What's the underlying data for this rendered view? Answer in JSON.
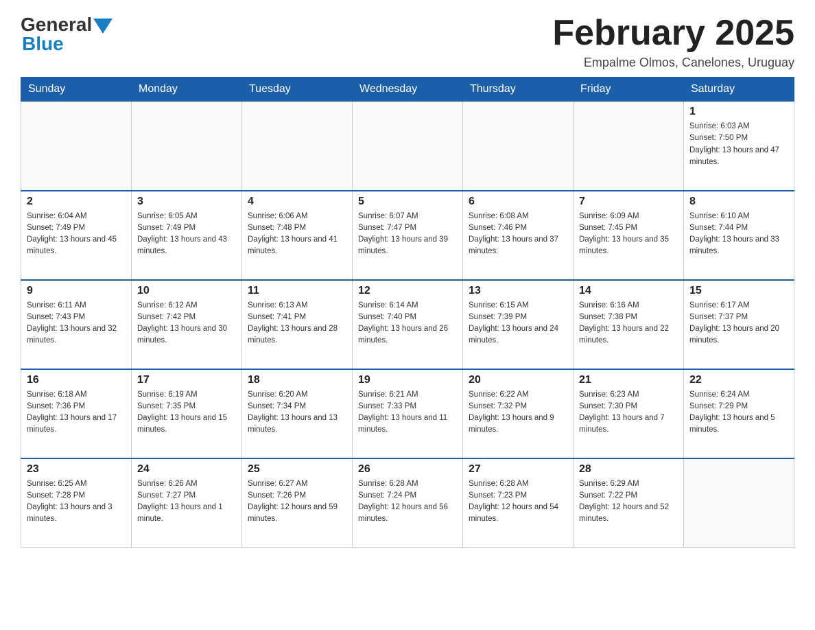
{
  "header": {
    "logo_general": "General",
    "logo_blue": "Blue",
    "month_title": "February 2025",
    "subtitle": "Empalme Olmos, Canelones, Uruguay"
  },
  "days_of_week": [
    "Sunday",
    "Monday",
    "Tuesday",
    "Wednesday",
    "Thursday",
    "Friday",
    "Saturday"
  ],
  "weeks": [
    {
      "days": [
        {
          "number": "",
          "info": ""
        },
        {
          "number": "",
          "info": ""
        },
        {
          "number": "",
          "info": ""
        },
        {
          "number": "",
          "info": ""
        },
        {
          "number": "",
          "info": ""
        },
        {
          "number": "",
          "info": ""
        },
        {
          "number": "1",
          "info": "Sunrise: 6:03 AM\nSunset: 7:50 PM\nDaylight: 13 hours and 47 minutes."
        }
      ]
    },
    {
      "days": [
        {
          "number": "2",
          "info": "Sunrise: 6:04 AM\nSunset: 7:49 PM\nDaylight: 13 hours and 45 minutes."
        },
        {
          "number": "3",
          "info": "Sunrise: 6:05 AM\nSunset: 7:49 PM\nDaylight: 13 hours and 43 minutes."
        },
        {
          "number": "4",
          "info": "Sunrise: 6:06 AM\nSunset: 7:48 PM\nDaylight: 13 hours and 41 minutes."
        },
        {
          "number": "5",
          "info": "Sunrise: 6:07 AM\nSunset: 7:47 PM\nDaylight: 13 hours and 39 minutes."
        },
        {
          "number": "6",
          "info": "Sunrise: 6:08 AM\nSunset: 7:46 PM\nDaylight: 13 hours and 37 minutes."
        },
        {
          "number": "7",
          "info": "Sunrise: 6:09 AM\nSunset: 7:45 PM\nDaylight: 13 hours and 35 minutes."
        },
        {
          "number": "8",
          "info": "Sunrise: 6:10 AM\nSunset: 7:44 PM\nDaylight: 13 hours and 33 minutes."
        }
      ]
    },
    {
      "days": [
        {
          "number": "9",
          "info": "Sunrise: 6:11 AM\nSunset: 7:43 PM\nDaylight: 13 hours and 32 minutes."
        },
        {
          "number": "10",
          "info": "Sunrise: 6:12 AM\nSunset: 7:42 PM\nDaylight: 13 hours and 30 minutes."
        },
        {
          "number": "11",
          "info": "Sunrise: 6:13 AM\nSunset: 7:41 PM\nDaylight: 13 hours and 28 minutes."
        },
        {
          "number": "12",
          "info": "Sunrise: 6:14 AM\nSunset: 7:40 PM\nDaylight: 13 hours and 26 minutes."
        },
        {
          "number": "13",
          "info": "Sunrise: 6:15 AM\nSunset: 7:39 PM\nDaylight: 13 hours and 24 minutes."
        },
        {
          "number": "14",
          "info": "Sunrise: 6:16 AM\nSunset: 7:38 PM\nDaylight: 13 hours and 22 minutes."
        },
        {
          "number": "15",
          "info": "Sunrise: 6:17 AM\nSunset: 7:37 PM\nDaylight: 13 hours and 20 minutes."
        }
      ]
    },
    {
      "days": [
        {
          "number": "16",
          "info": "Sunrise: 6:18 AM\nSunset: 7:36 PM\nDaylight: 13 hours and 17 minutes."
        },
        {
          "number": "17",
          "info": "Sunrise: 6:19 AM\nSunset: 7:35 PM\nDaylight: 13 hours and 15 minutes."
        },
        {
          "number": "18",
          "info": "Sunrise: 6:20 AM\nSunset: 7:34 PM\nDaylight: 13 hours and 13 minutes."
        },
        {
          "number": "19",
          "info": "Sunrise: 6:21 AM\nSunset: 7:33 PM\nDaylight: 13 hours and 11 minutes."
        },
        {
          "number": "20",
          "info": "Sunrise: 6:22 AM\nSunset: 7:32 PM\nDaylight: 13 hours and 9 minutes."
        },
        {
          "number": "21",
          "info": "Sunrise: 6:23 AM\nSunset: 7:30 PM\nDaylight: 13 hours and 7 minutes."
        },
        {
          "number": "22",
          "info": "Sunrise: 6:24 AM\nSunset: 7:29 PM\nDaylight: 13 hours and 5 minutes."
        }
      ]
    },
    {
      "days": [
        {
          "number": "23",
          "info": "Sunrise: 6:25 AM\nSunset: 7:28 PM\nDaylight: 13 hours and 3 minutes."
        },
        {
          "number": "24",
          "info": "Sunrise: 6:26 AM\nSunset: 7:27 PM\nDaylight: 13 hours and 1 minute."
        },
        {
          "number": "25",
          "info": "Sunrise: 6:27 AM\nSunset: 7:26 PM\nDaylight: 12 hours and 59 minutes."
        },
        {
          "number": "26",
          "info": "Sunrise: 6:28 AM\nSunset: 7:24 PM\nDaylight: 12 hours and 56 minutes."
        },
        {
          "number": "27",
          "info": "Sunrise: 6:28 AM\nSunset: 7:23 PM\nDaylight: 12 hours and 54 minutes."
        },
        {
          "number": "28",
          "info": "Sunrise: 6:29 AM\nSunset: 7:22 PM\nDaylight: 12 hours and 52 minutes."
        },
        {
          "number": "",
          "info": ""
        }
      ]
    }
  ]
}
